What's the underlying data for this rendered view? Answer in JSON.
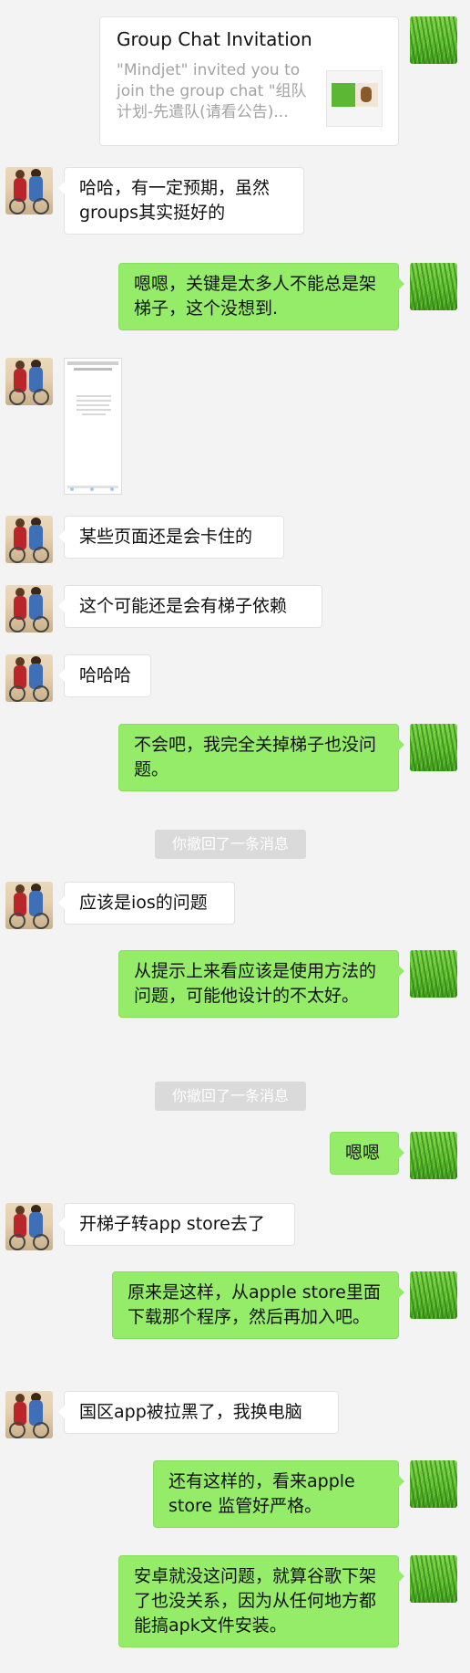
{
  "invitation": {
    "title": "Group Chat Invitation",
    "description": "\"Mindjet\" invited you to join the group chat \"组队计划-先遣队(请看公告)..."
  },
  "messages": [
    {
      "side": "left",
      "text": "哈哈，有一定预期，虽然groups其实挺好的"
    },
    {
      "side": "right",
      "text": "嗯嗯，关键是太多人不能总是架梯子，这个没想到."
    },
    {
      "side": "left",
      "text": "某些页面还是会卡住的"
    },
    {
      "side": "left",
      "text": "这个可能还是会有梯子依赖"
    },
    {
      "side": "left",
      "text": "哈哈哈"
    },
    {
      "side": "right",
      "text": "不会吧，我完全关掉梯子也没问题。"
    },
    {
      "side": "left",
      "text": "应该是ios的问题"
    },
    {
      "side": "right",
      "text": "从提示上来看应该是使用方法的问题，可能他设计的不太好。"
    },
    {
      "side": "right",
      "text": "嗯嗯"
    },
    {
      "side": "left",
      "text": "开梯子转app store去了"
    },
    {
      "side": "right",
      "text": "原来是这样，从apple store里面下载那个程序，然后再加入吧。"
    },
    {
      "side": "left",
      "text": "国区app被拉黑了，我换电脑"
    },
    {
      "side": "right",
      "text": "还有这样的，看来apple store 监管好严格。"
    },
    {
      "side": "right",
      "text": "安卓就没这问题，就算谷歌下架了也没关系，因为从任何地方都能搞apk文件安装。"
    }
  ],
  "notices": [
    "你撤回了一条消息",
    "你撤回了一条消息"
  ],
  "colors": {
    "background": "#f3f3f3",
    "bubble_green": "#95ec69",
    "bubble_white": "#ffffff",
    "notice": "#dadada"
  }
}
